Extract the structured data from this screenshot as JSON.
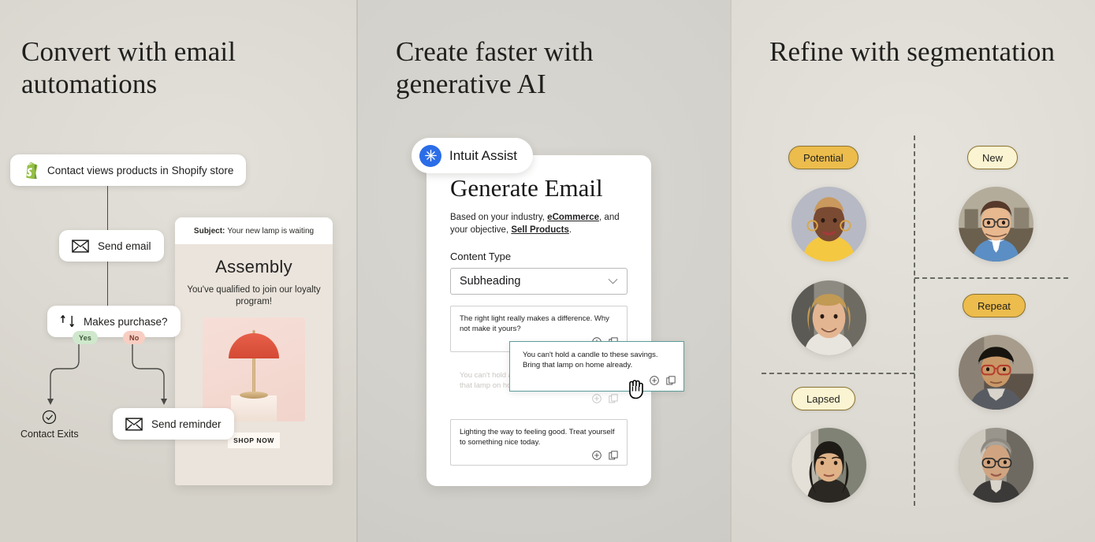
{
  "panels": {
    "left": {
      "heading": "Convert with email\nautomations",
      "flow": {
        "trigger": {
          "label": "Contact views products in Shopify store",
          "icon": "shopify-icon"
        },
        "send_email": {
          "label": "Send email",
          "icon": "envelope-icon"
        },
        "condition": {
          "label": "Makes purchase?",
          "icon": "branch-icon"
        },
        "branch_yes": "Yes",
        "branch_no": "No",
        "exit": {
          "label": "Contact Exits",
          "icon": "check-circle-icon"
        },
        "send_reminder": {
          "label": "Send reminder",
          "icon": "envelope-icon"
        }
      },
      "email_preview": {
        "subject_label": "Subject:",
        "subject_value": "Your new lamp is waiting",
        "brand": "Assembly",
        "body": "You've qualified to join\nour loyalty program!",
        "cta": "SHOP NOW"
      }
    },
    "middle": {
      "heading": "Create faster with\ngenerative AI",
      "assist_badge": {
        "name": "Intuit Assist",
        "icon": "sparkle-icon"
      },
      "card": {
        "title": "Generate Email",
        "subtitle_parts": {
          "a": "Based on your industry, ",
          "industry": "eCommerce",
          "b": ",",
          "c": "and your objective, ",
          "objective": "Sell Products",
          "d": "."
        },
        "content_type_label": "Content Type",
        "content_type_value": "Subheading",
        "suggestions": [
          {
            "text": "The right light really makes a difference. Why not make it yours?",
            "state": "normal"
          },
          {
            "text": "You can't hold a candle to these savings. Bring that lamp on home already.",
            "state": "ghost"
          },
          {
            "text": "Lighting the way to feeling good. Treat yourself to something nice today.",
            "state": "normal"
          }
        ],
        "dragging_card": {
          "text": "You can't hold a candle to these savings. Bring that lamp on home already.",
          "border_color": "#5e9c99"
        },
        "action_icons": [
          "plus-circle-icon",
          "copy-icon"
        ]
      }
    },
    "right": {
      "heading": "Refine with segmentation",
      "segments": [
        {
          "label": "Potential",
          "style": "gold",
          "quadrant": "top-left"
        },
        {
          "label": "New",
          "style": "cream",
          "quadrant": "top-right"
        },
        {
          "label": "Repeat",
          "style": "gold",
          "quadrant": "bottom-right"
        },
        {
          "label": "Lapsed",
          "style": "cream",
          "quadrant": "bottom-left"
        }
      ],
      "avatars": [
        {
          "name": "avatar-potential-1"
        },
        {
          "name": "avatar-potential-2"
        },
        {
          "name": "avatar-new-1"
        },
        {
          "name": "avatar-repeat-1"
        },
        {
          "name": "avatar-repeat-2"
        },
        {
          "name": "avatar-lapsed-1"
        }
      ]
    }
  },
  "colors": {
    "accent_gold": "#ecbc4c",
    "accent_cream": "#fbf4d2",
    "drag_border": "#5e9c99",
    "assist_blue": "#2b6de8",
    "shopify_green": "#7ab55c",
    "yes_green": "#cfe8cc",
    "no_red": "#f8cec3"
  }
}
